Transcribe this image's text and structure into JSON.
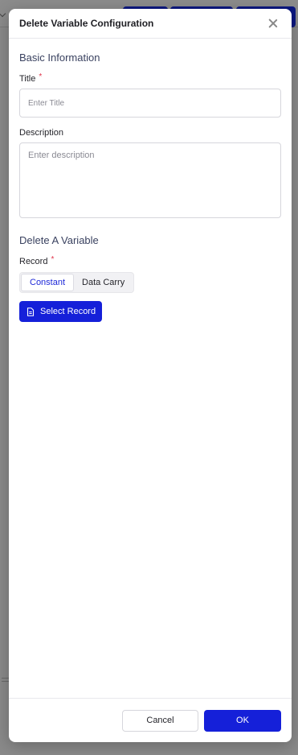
{
  "modal": {
    "title": "Delete Variable Configuration",
    "basic_section": "Basic Information",
    "title_label": "Title",
    "title_placeholder": "Enter Title",
    "description_label": "Description",
    "description_placeholder": "Enter description",
    "delete_section": "Delete A Variable",
    "record_label": "Record",
    "record_modes": [
      "Constant",
      "Data Carry"
    ],
    "record_mode_selected": "Constant",
    "select_record_label": "Select Record",
    "required_marker": "*"
  },
  "footer": {
    "cancel_label": "Cancel",
    "ok_label": "OK"
  },
  "colors": {
    "accent": "#1520d9",
    "required": "#e0344a",
    "overlay": "#8a8a8a"
  }
}
